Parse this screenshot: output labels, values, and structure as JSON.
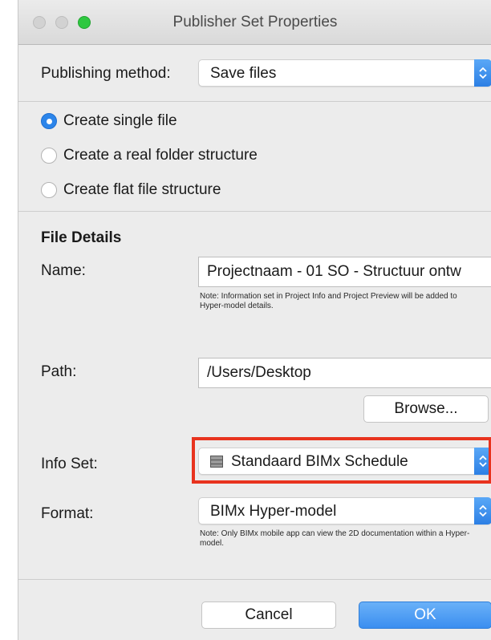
{
  "window": {
    "title": "Publisher Set Properties"
  },
  "publishing_method": {
    "label": "Publishing method:",
    "value": "Save files"
  },
  "radios": [
    {
      "label": "Create single file",
      "selected": true
    },
    {
      "label": "Create a real folder structure",
      "selected": false
    },
    {
      "label": "Create flat file structure",
      "selected": false
    }
  ],
  "file_details": {
    "heading": "File Details",
    "name_label": "Name:",
    "name_value": "Projectnaam - 01 SO - Structuur ontw",
    "name_note": "Note: Information set in Project Info and Project Preview will be added to Hyper-model details.",
    "path_label": "Path:",
    "path_value": "/Users/Desktop",
    "browse_label": "Browse...",
    "info_set_label": "Info Set:",
    "info_set_value": "Standaard BIMx Schedule",
    "format_label": "Format:",
    "format_value": "BIMx Hyper-model",
    "format_note": "Note: Only BIMx mobile app can view the 2D documentation within a Hyper-model."
  },
  "buttons": {
    "cancel": "Cancel",
    "ok": "OK"
  },
  "colors": {
    "accent": "#2c85ea",
    "highlight": "#e8331e",
    "zoom_light": "#2fc840"
  }
}
